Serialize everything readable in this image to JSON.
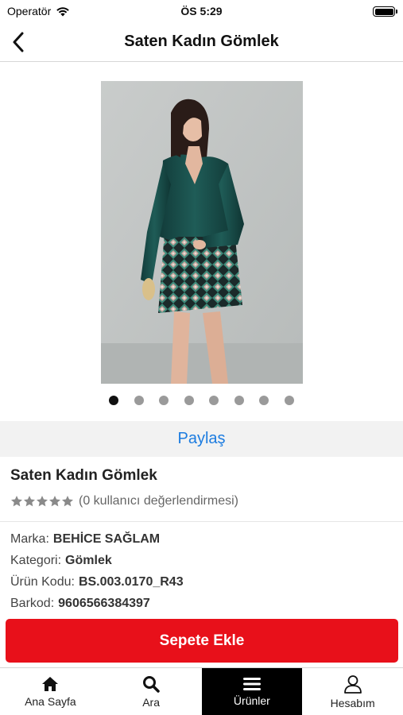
{
  "status_bar": {
    "carrier": "Operatör",
    "time": "ÖS 5:29"
  },
  "nav": {
    "title": "Saten Kadın Gömlek",
    "back_icon": "chevron-left-icon"
  },
  "carousel": {
    "total": 8,
    "active_index": 0
  },
  "share": {
    "label": "Paylaş"
  },
  "product": {
    "name": "Saten Kadın Gömlek",
    "rating": 0,
    "rating_max": 5,
    "review_text": "(0 kullanıcı değerlendirmesi)",
    "specs": [
      {
        "label": "Marka:",
        "value": "BEHİCE SAĞLAM"
      },
      {
        "label": "Kategori:",
        "value": "Gömlek"
      },
      {
        "label": "Ürün Kodu:",
        "value": "BS.003.0170_R43"
      },
      {
        "label": "Barkod:",
        "value": "9606566384397"
      }
    ]
  },
  "cart": {
    "label": "Sepete Ekle",
    "color": "#e8101a"
  },
  "tabs": [
    {
      "label": "Ana Sayfa",
      "icon": "home-icon",
      "active": false
    },
    {
      "label": "Ara",
      "icon": "search-icon",
      "active": false
    },
    {
      "label": "Ürünler",
      "icon": "menu-icon",
      "active": true
    },
    {
      "label": "Hesabım",
      "icon": "user-icon",
      "active": false
    }
  ]
}
